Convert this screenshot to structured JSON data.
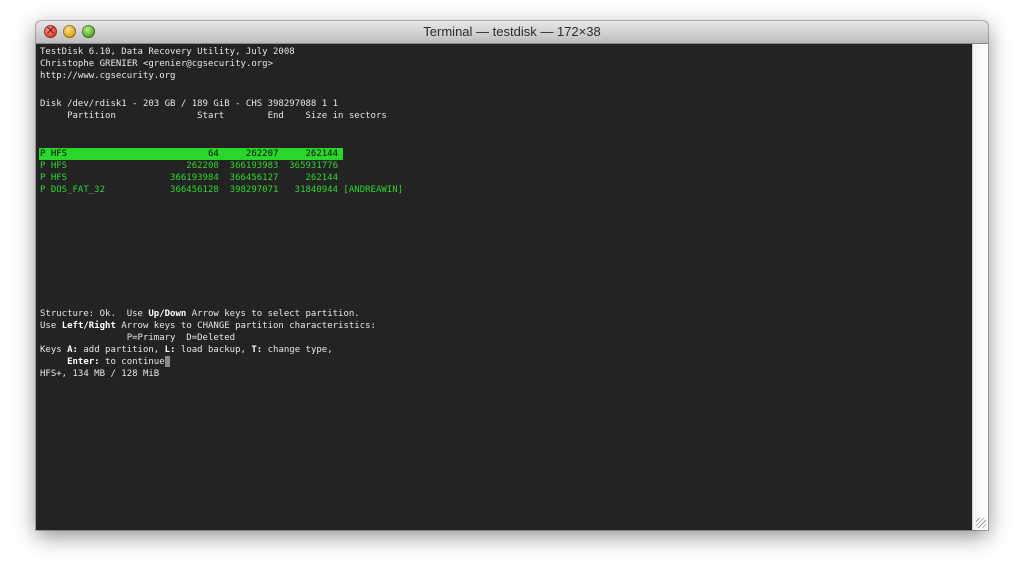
{
  "window": {
    "title": "Terminal — testdisk — 172×38"
  },
  "terminal": {
    "header": [
      "TestDisk 6.10, Data Recovery Utility, July 2008",
      "Christophe GRENIER <grenier@cgsecurity.org>",
      "http://www.cgsecurity.org"
    ],
    "disk_line": "Disk /dev/rdisk1 - 203 GB / 189 GiB - CHS 398297088 1 1",
    "columns_line": "     Partition               Start        End    Size in sectors",
    "partitions": [
      "P HFS                          64     262207     262144",
      "P HFS                      262208  366193983  365931776",
      "P HFS                   366193984  366456127     262144",
      "P DOS_FAT_32            366456128  398297071   31840944 [ANDREAWIN]"
    ],
    "footer": {
      "l1_a": "Structure: Ok.  Use ",
      "l1_b": "Up/Down",
      "l1_c": " Arrow keys to select partition.",
      "l2_a": "Use ",
      "l2_b": "Left/Right",
      "l2_c": " Arrow keys to CHANGE partition characteristics:",
      "l3": "                P=Primary  D=Deleted",
      "l4_a": "Keys ",
      "l4_b": "A:",
      "l4_c": " add partition, ",
      "l4_d": "L:",
      "l4_e": " load backup, ",
      "l4_f": "T:",
      "l4_g": " change type,",
      "l5_a": "     ",
      "l5_b": "Enter:",
      "l5_c": " to continue",
      "l6": "HFS+, 134 MB / 128 MiB"
    }
  },
  "colors": {
    "terminal_bg": "#232323",
    "text": "#e6e6e6",
    "partition_green": "#2fd62f",
    "selection_bg": "#29d629"
  }
}
